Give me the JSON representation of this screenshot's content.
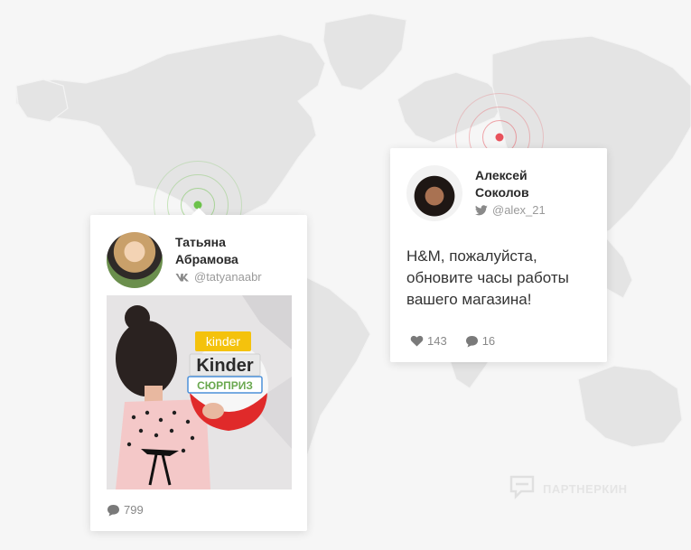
{
  "pins": {
    "green_color": "#6cc24a",
    "red_color": "#e8525c"
  },
  "left_card": {
    "name": "Татьяна Абрамова",
    "network_icon": "vk-icon",
    "handle": "@tatyanaabr",
    "comments": "799",
    "image_text_top": "kinder",
    "image_text_brand": "Kinder",
    "image_text_sub": "СЮРПРИЗ"
  },
  "right_card": {
    "name": "Алексей Соколов",
    "network_icon": "twitter-icon",
    "handle": "@alex_21",
    "text": "H&M, пожалуйста, обновите часы работы вашего магазина!",
    "likes": "143",
    "comments": "16"
  },
  "watermark": {
    "text": "ПАРТНЕРКИН",
    "icon": "chat-bubble-icon"
  }
}
